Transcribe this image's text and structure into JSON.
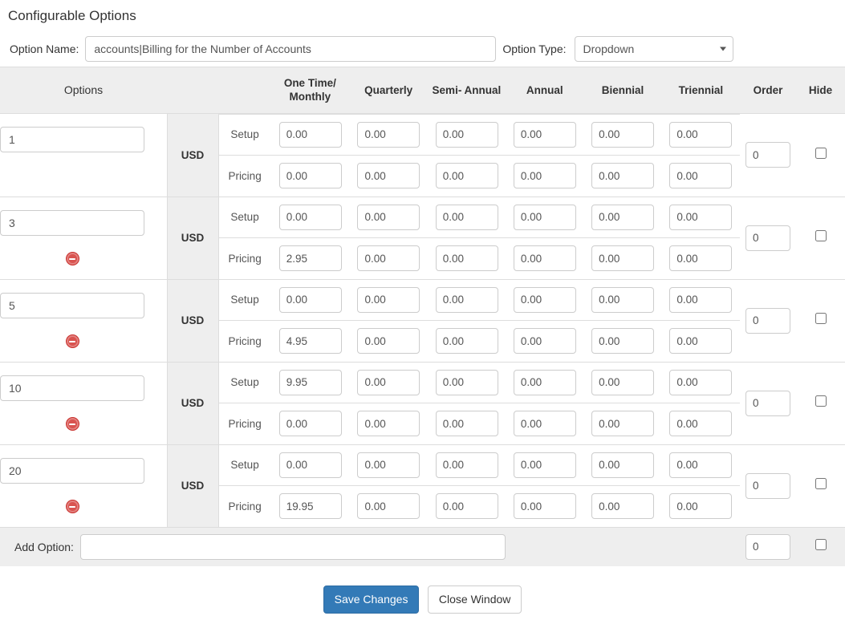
{
  "panel": {
    "title": "Configurable Options"
  },
  "meta": {
    "option_name_label": "Option Name:",
    "option_name_value": "accounts|Billing for the Number of Accounts",
    "option_name_placeholder": "",
    "option_type_label": "Option Type:",
    "option_type_value": "Dropdown",
    "option_type_options": [
      "Dropdown"
    ]
  },
  "table": {
    "headers": {
      "options": "Options",
      "one_time_monthly": "One Time/ Monthly",
      "quarterly": "Quarterly",
      "semi_annual": "Semi- Annual",
      "annual": "Annual",
      "biennial": "Biennial",
      "triennial": "Triennial",
      "order": "Order",
      "hide": "Hide"
    },
    "sub_labels": {
      "setup": "Setup",
      "pricing": "Pricing"
    },
    "currency": "USD",
    "delete_icon": "remove-circle-icon",
    "rows": [
      {
        "name": "1",
        "deletable": false,
        "order": "0",
        "hidden": false,
        "setup": [
          "0.00",
          "0.00",
          "0.00",
          "0.00",
          "0.00",
          "0.00"
        ],
        "pricing": [
          "0.00",
          "0.00",
          "0.00",
          "0.00",
          "0.00",
          "0.00"
        ]
      },
      {
        "name": "3",
        "deletable": true,
        "order": "0",
        "hidden": false,
        "setup": [
          "0.00",
          "0.00",
          "0.00",
          "0.00",
          "0.00",
          "0.00"
        ],
        "pricing": [
          "2.95",
          "0.00",
          "0.00",
          "0.00",
          "0.00",
          "0.00"
        ]
      },
      {
        "name": "5",
        "deletable": true,
        "order": "0",
        "hidden": false,
        "setup": [
          "0.00",
          "0.00",
          "0.00",
          "0.00",
          "0.00",
          "0.00"
        ],
        "pricing": [
          "4.95",
          "0.00",
          "0.00",
          "0.00",
          "0.00",
          "0.00"
        ]
      },
      {
        "name": "10",
        "deletable": true,
        "order": "0",
        "hidden": false,
        "setup": [
          "9.95",
          "0.00",
          "0.00",
          "0.00",
          "0.00",
          "0.00"
        ],
        "pricing": [
          "0.00",
          "0.00",
          "0.00",
          "0.00",
          "0.00",
          "0.00"
        ]
      },
      {
        "name": "20",
        "deletable": true,
        "order": "0",
        "hidden": false,
        "setup": [
          "0.00",
          "0.00",
          "0.00",
          "0.00",
          "0.00",
          "0.00"
        ],
        "pricing": [
          "19.95",
          "0.00",
          "0.00",
          "0.00",
          "0.00",
          "0.00"
        ]
      }
    ],
    "add_row": {
      "label": "Add Option:",
      "value": "",
      "placeholder": "",
      "order": "0",
      "hidden": false
    }
  },
  "footer": {
    "save_label": "Save Changes",
    "close_label": "Close Window"
  },
  "colors": {
    "primary": "#337ab7",
    "primary_border": "#2e6da4",
    "header_bg": "#eeeeee",
    "border": "#dddddd",
    "delete": "#d9534f"
  }
}
